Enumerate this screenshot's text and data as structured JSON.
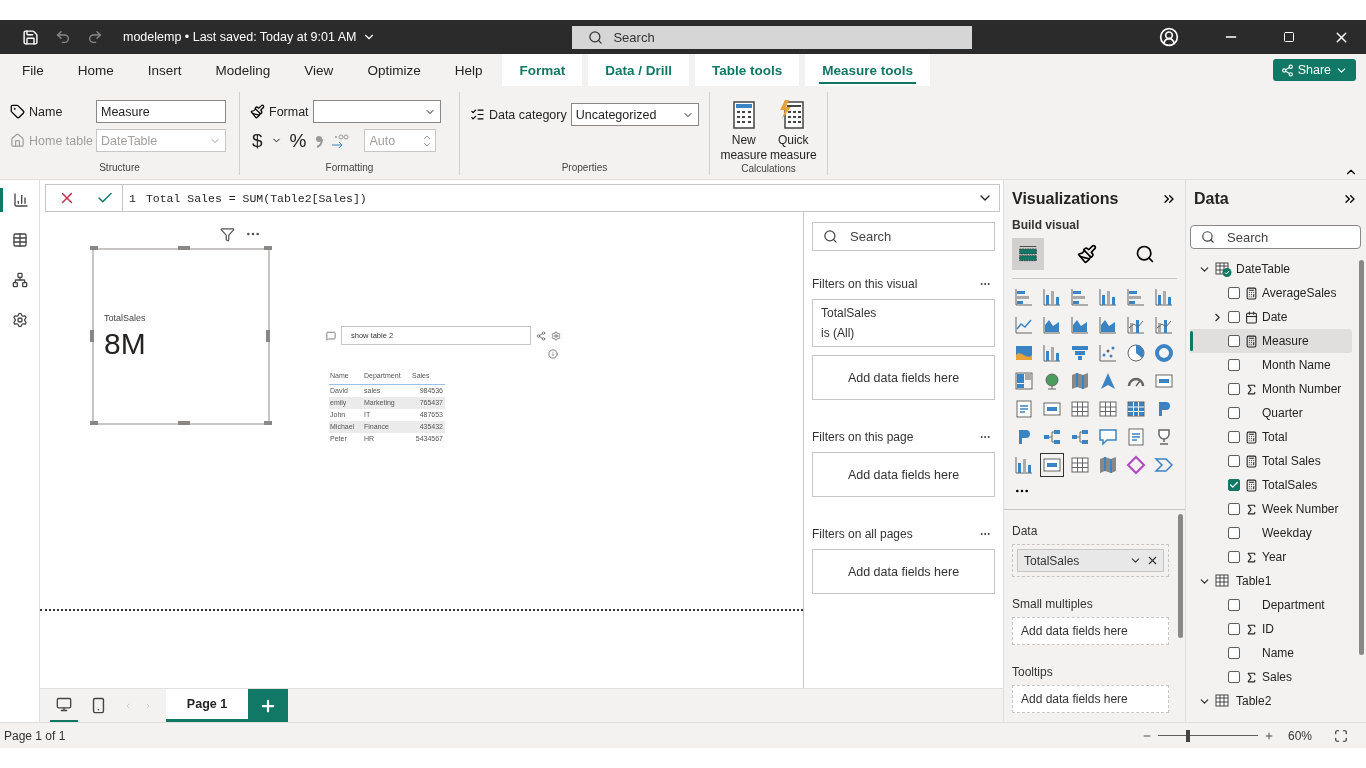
{
  "title_bar": {
    "file_info": "modelemp • Last saved: Today at 9:01 AM",
    "search": {
      "placeholder": "Search"
    }
  },
  "ribbon_tabs": [
    {
      "label": "File",
      "kind": "main",
      "selected": false
    },
    {
      "label": "Home",
      "kind": "main",
      "selected": false
    },
    {
      "label": "Insert",
      "kind": "main",
      "selected": false
    },
    {
      "label": "Modeling",
      "kind": "main",
      "selected": false
    },
    {
      "label": "View",
      "kind": "main",
      "selected": false
    },
    {
      "label": "Optimize",
      "kind": "main",
      "selected": false
    },
    {
      "label": "Help",
      "kind": "main",
      "selected": false
    },
    {
      "label": "Format",
      "kind": "contextual",
      "selected": false
    },
    {
      "label": "Data / Drill",
      "kind": "contextual",
      "selected": false
    },
    {
      "label": "Table tools",
      "kind": "contextual",
      "selected": false
    },
    {
      "label": "Measure tools",
      "kind": "contextual",
      "selected": true
    }
  ],
  "share_button": "Share",
  "ribbon": {
    "structure": {
      "title": "Structure",
      "name_label": "Name",
      "name_value": "Measure",
      "home_table_label": "Home table",
      "home_table_value": "DateTable",
      "home_table_disabled": true
    },
    "formatting": {
      "title": "Formatting",
      "format_label": "Format",
      "currency_symbol": "$",
      "percent_symbol": "%",
      "decimals_placeholder": "Auto",
      "decimals_disabled": true
    },
    "properties": {
      "title": "Properties",
      "data_category_label": "Data category",
      "data_category_value": "Uncategorized"
    },
    "calculations": {
      "title": "Calculations",
      "buttons": [
        {
          "label": "New measure",
          "kind": "new"
        },
        {
          "label": "Quick measure",
          "kind": "quick"
        }
      ]
    }
  },
  "nav": [
    {
      "kind": "report",
      "selected": true
    },
    {
      "kind": "table",
      "selected": false
    },
    {
      "kind": "model",
      "selected": false
    },
    {
      "kind": "dax",
      "selected": false
    }
  ],
  "formula": {
    "line_number": "1",
    "text": "Total Sales = SUM(Table2[Sales])"
  },
  "canvas": {
    "card": {
      "label": "TotalSales",
      "value": "8M",
      "selected": true
    },
    "qa": {
      "question": "show table 2",
      "columns": [
        "Name",
        "Department",
        "Sales"
      ],
      "rows": [
        [
          "David",
          "sales",
          "984536"
        ],
        [
          "emily",
          "Marketing",
          "765437"
        ],
        [
          "John",
          "IT",
          "487653"
        ],
        [
          "Michael",
          "Finance",
          "435432"
        ],
        [
          "Peter",
          "HR",
          "5434567"
        ]
      ]
    }
  },
  "filters": {
    "search_placeholder": "Search",
    "sections": [
      {
        "title": "Filters on this visual",
        "filters": [
          {
            "field": "TotalSales",
            "condition": "is (All)"
          }
        ],
        "drop_hint": "Add data fields here"
      },
      {
        "title": "Filters on this page",
        "drop_hint": "Add data fields here"
      },
      {
        "title": "Filters on all pages",
        "drop_hint": "Add data fields here"
      }
    ]
  },
  "visualizations": {
    "title": "Visualizations",
    "build_label": "Build visual",
    "build_tabs": [
      {
        "selected": true
      },
      {
        "selected": false
      },
      {
        "selected": false
      }
    ],
    "visual_types": [
      {
        "selected": false
      },
      {
        "selected": false
      },
      {
        "selected": false
      },
      {
        "selected": false
      },
      {
        "selected": false
      },
      {
        "selected": false
      },
      {
        "selected": false
      },
      {
        "selected": false
      },
      {
        "selected": false
      },
      {
        "selected": false
      },
      {
        "selected": false
      },
      {
        "selected": false
      },
      {
        "selected": false
      },
      {
        "selected": false
      },
      {
        "selected": false
      },
      {
        "selected": false
      },
      {
        "selected": false
      },
      {
        "selected": false
      },
      {
        "selected": false
      },
      {
        "selected": false
      },
      {
        "selected": false
      },
      {
        "selected": false
      },
      {
        "selected": false
      },
      {
        "selected": false
      },
      {
        "selected": false
      },
      {
        "selected": false
      },
      {
        "selected": false
      },
      {
        "selected": false
      },
      {
        "selected": false
      },
      {
        "selected": false
      },
      {
        "selected": false
      },
      {
        "selected": false
      },
      {
        "selected": false
      },
      {
        "selected": false
      },
      {
        "selected": false
      },
      {
        "selected": false
      },
      {
        "selected": false
      },
      {
        "selected": true
      },
      {
        "selected": false
      },
      {
        "selected": false
      },
      {
        "selected": false
      },
      {
        "selected": false
      }
    ],
    "wells": [
      {
        "label": "Data",
        "fields": [
          "TotalSales"
        ]
      },
      {
        "label": "Small multiples",
        "placeholder": "Add data fields here"
      },
      {
        "label": "Tooltips",
        "placeholder": "Add data fields here"
      }
    ]
  },
  "data_pane": {
    "title": "Data",
    "search_placeholder": "Search",
    "tables": [
      {
        "name": "DateTable",
        "kind": "date_table",
        "expanded": true,
        "children": [
          {
            "name": "AverageSales",
            "kind": "measure",
            "checked": false,
            "selected": false
          },
          {
            "name": "Date",
            "kind": "date",
            "checked": false,
            "selected": false
          },
          {
            "name": "Measure",
            "kind": "measure",
            "checked": false,
            "selected": true
          },
          {
            "name": "Month Name",
            "kind": "text",
            "checked": false,
            "selected": false
          },
          {
            "name": "Month Number",
            "kind": "sum",
            "checked": false,
            "selected": false
          },
          {
            "name": "Quarter",
            "kind": "text",
            "checked": false,
            "selected": false
          },
          {
            "name": "Total",
            "kind": "measure",
            "checked": false,
            "selected": false
          },
          {
            "name": "Total Sales",
            "kind": "measure",
            "checked": false,
            "selected": false
          },
          {
            "name": "TotalSales",
            "kind": "measure",
            "checked": true,
            "selected": false
          },
          {
            "name": "Week Number",
            "kind": "sum",
            "checked": false,
            "selected": false
          },
          {
            "name": "Weekday",
            "kind": "text",
            "checked": false,
            "selected": false
          },
          {
            "name": "Year",
            "kind": "sum",
            "checked": false,
            "selected": false
          }
        ]
      },
      {
        "name": "Table1",
        "kind": "table",
        "expanded": true,
        "children": [
          {
            "name": "Department",
            "kind": "text",
            "checked": false,
            "selected": false
          },
          {
            "name": "ID",
            "kind": "sum",
            "checked": false,
            "selected": false
          },
          {
            "name": "Name",
            "kind": "text",
            "checked": false,
            "selected": false
          },
          {
            "name": "Sales",
            "kind": "sum",
            "checked": false,
            "selected": false
          }
        ]
      },
      {
        "name": "Table2",
        "kind": "table",
        "expanded": true
      }
    ]
  },
  "page_tabs": [
    {
      "label": "Page 1",
      "selected": true
    }
  ],
  "status_bar": {
    "page_info": "Page 1 of 1",
    "zoom": {
      "level": 0.3,
      "reading": "60%"
    }
  }
}
